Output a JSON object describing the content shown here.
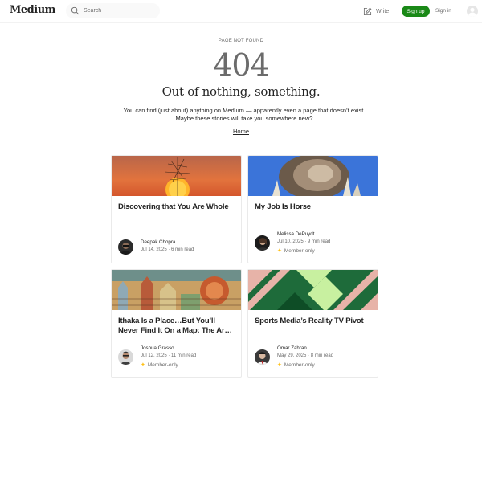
{
  "header": {
    "logo": "Medium",
    "search_placeholder": "Search",
    "write_label": "Write",
    "signup_label": "Sign up",
    "signin_label": "Sign in"
  },
  "not_found": {
    "label": "PAGE NOT FOUND",
    "code": "404",
    "title": "Out of nothing, something.",
    "body_line1": "You can find (just about) anything on Medium — apparently even a page that doesn’t exist.",
    "body_line2": "Maybe these stories will take you somewhere new?",
    "home_link": "Home"
  },
  "stories": [
    {
      "title": "Discovering that You Are Whole",
      "author": "Deepak Chopra",
      "meta": "Jul 14, 2025 · 6 min read",
      "member_only": ""
    },
    {
      "title": "My Job Is Horse",
      "author": "Melissa DePuydt",
      "meta": "Jul 10, 2025 · 9 min read",
      "member_only": "Member-only"
    },
    {
      "title_line1": "Ithaka Is a Place…But You’ll",
      "title_line2": "Never Find It On a Map: The Ar…",
      "author": "Joshua Grasso",
      "meta": "Jul 12, 2025 · 11 min read",
      "member_only": "Member-only"
    },
    {
      "title": "Sports Media’s Reality TV Pivot",
      "author": "Omar Zahran",
      "meta": "May 29, 2025 · 8 min read",
      "member_only": "Member-only"
    }
  ],
  "colors": {
    "accent": "#1a8917",
    "member_star": "#ffc017",
    "text": "#242424",
    "muted": "#6b6b6b"
  }
}
